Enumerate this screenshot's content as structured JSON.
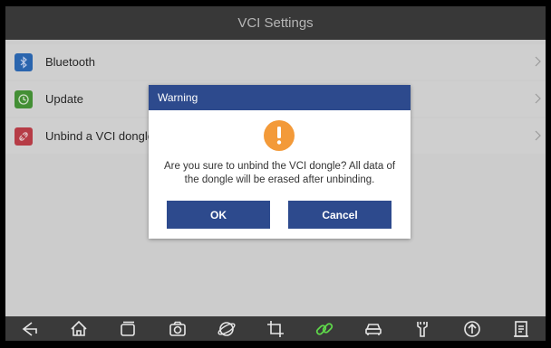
{
  "header": {
    "title": "VCI Settings"
  },
  "menu": {
    "items": [
      {
        "label": "Bluetooth",
        "icon": "bluetooth-icon",
        "color": "#2f6fc0"
      },
      {
        "label": "Update",
        "icon": "update-icon",
        "color": "#4a9e3b"
      },
      {
        "label": "Unbind a VCI dongle",
        "icon": "unbind-icon",
        "color": "#c8434e"
      }
    ]
  },
  "dialog": {
    "title": "Warning",
    "message": "Are you sure to unbind the VCI dongle? All data of the dongle will be erased after unbinding.",
    "ok_label": "OK",
    "cancel_label": "Cancel",
    "accent": "#2d4a8d",
    "warning_color": "#f39a39"
  },
  "navbar": {
    "icons": [
      "back-icon",
      "home-icon",
      "recent-apps-icon",
      "camera-icon",
      "browser-icon",
      "crop-icon",
      "link-icon",
      "car-icon",
      "service-icon",
      "upload-icon",
      "report-icon"
    ],
    "active_color": "#5ed64a"
  }
}
